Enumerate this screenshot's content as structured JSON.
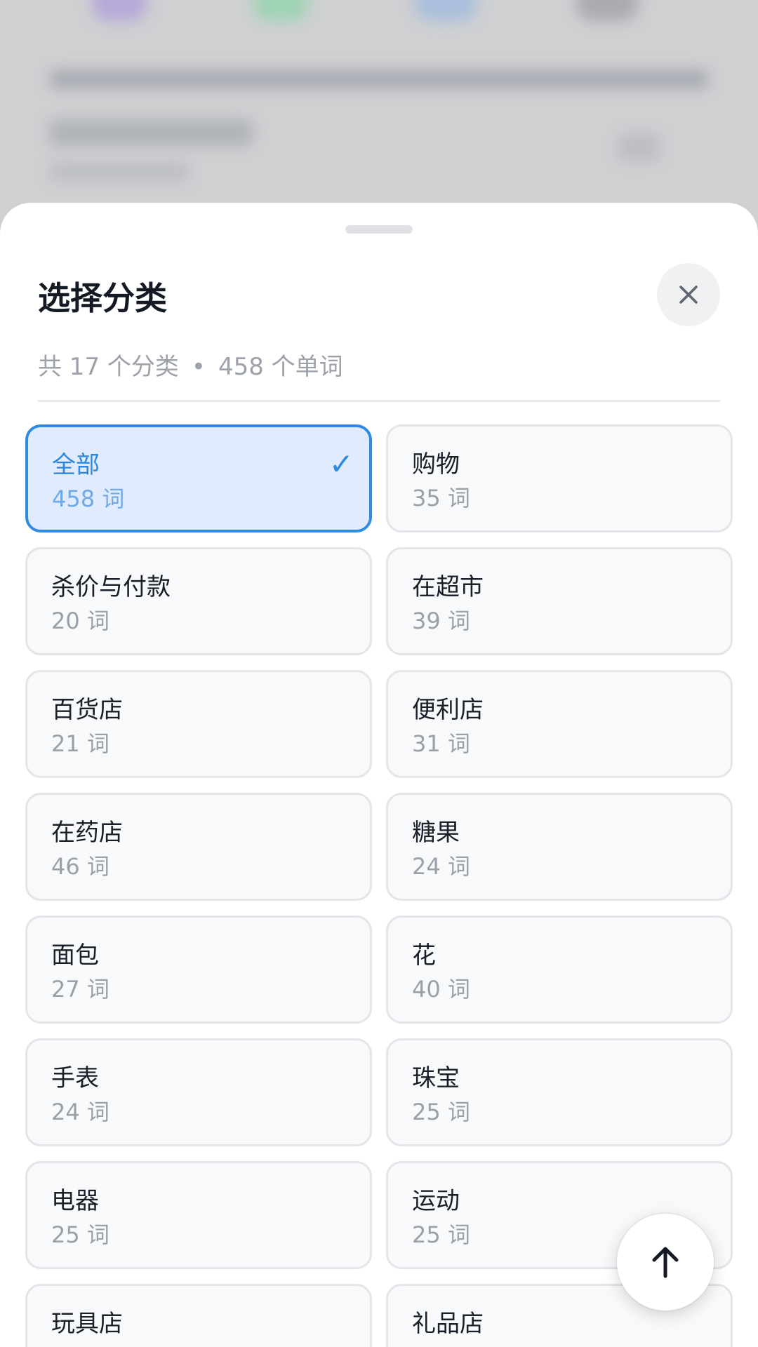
{
  "sheet": {
    "title": "选择分类",
    "summary": {
      "categories": "共 17 个分类",
      "separator": "•",
      "words": "458 个单词"
    },
    "close_icon": "close-icon",
    "scroll_top_icon": "arrow-up-icon"
  },
  "colors": {
    "accent": "#2f8ae0",
    "selected_bg": "#e0ecfd",
    "card_bg": "#f8f9fb"
  },
  "categories": [
    {
      "name": "全部",
      "count": "458 词",
      "selected": true
    },
    {
      "name": "购物",
      "count": "35 词"
    },
    {
      "name": "杀价与付款",
      "count": "20 词"
    },
    {
      "name": "在超市",
      "count": "39 词"
    },
    {
      "name": "百货店",
      "count": "21 词"
    },
    {
      "name": "便利店",
      "count": "31 词"
    },
    {
      "name": "在药店",
      "count": "46 词"
    },
    {
      "name": "糖果",
      "count": "24 词"
    },
    {
      "name": "面包",
      "count": "27 词"
    },
    {
      "name": "花",
      "count": "40 词"
    },
    {
      "name": "手表",
      "count": "24 词"
    },
    {
      "name": "珠宝",
      "count": "25 词"
    },
    {
      "name": "电器",
      "count": "25 词"
    },
    {
      "name": "运动",
      "count": "25 词"
    },
    {
      "name": "玩具店",
      "count": ""
    },
    {
      "name": "礼品店",
      "count": ""
    }
  ]
}
